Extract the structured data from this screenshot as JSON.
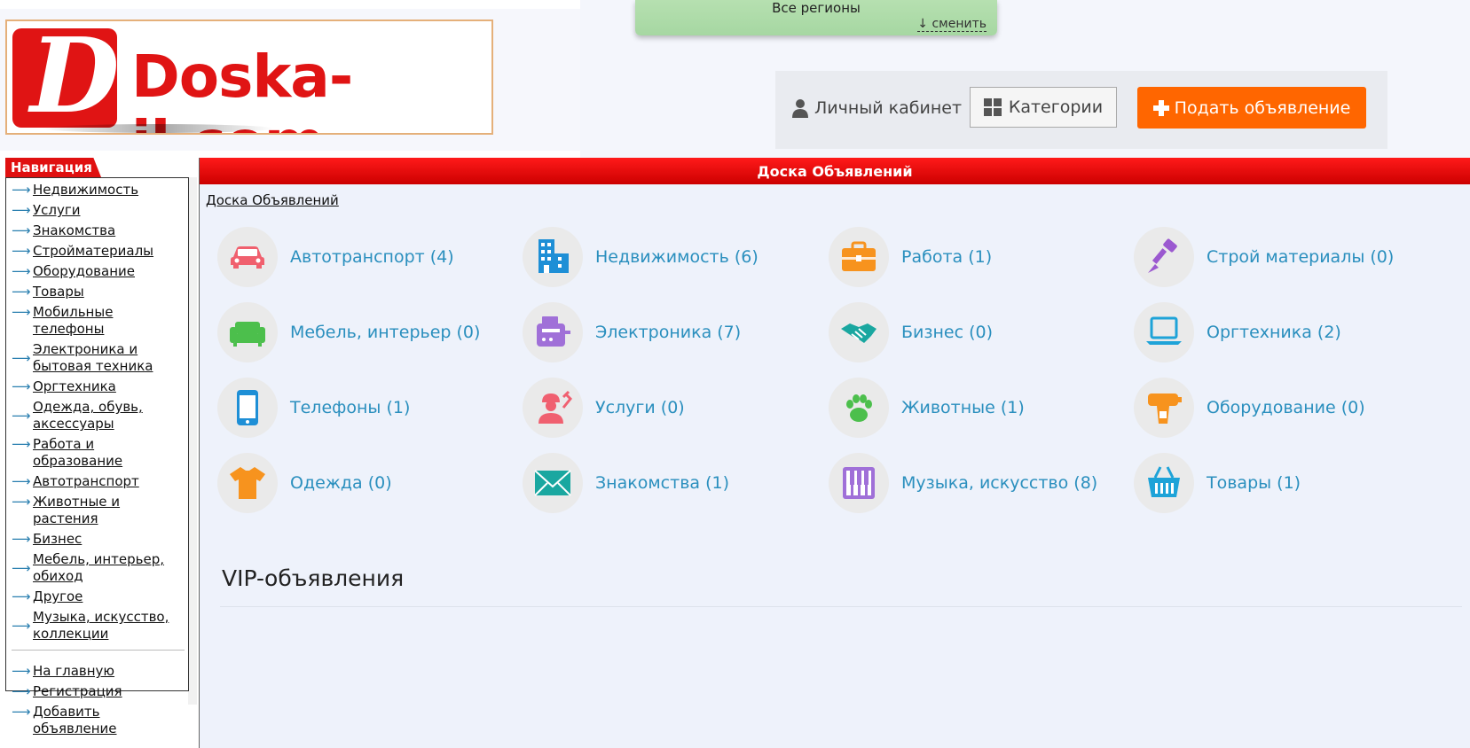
{
  "header": {
    "logo_text": "Doska-il.com",
    "region": {
      "label": "Все регионы",
      "change": "↓ сменить"
    },
    "toolbar": {
      "cabinet": "Личный кабинет",
      "categories": "Категории",
      "post_ad": "Подать объявление"
    }
  },
  "sidebar": {
    "title": "Навигация",
    "items": [
      "Недвижимость",
      "Услуги",
      "Знакомства",
      "Стройматериалы",
      "Оборудование",
      "Товары",
      "Мобильные телефоны",
      "Электроника и бытовая техника",
      "Оргтехника",
      "Одежда, обувь, аксессуары",
      "Работа и образование",
      "Автотранспорт",
      "Животные и растения",
      "Бизнес",
      "Мебель, интерьер, обиход",
      "Другое",
      "Музыка, искусство, коллекции"
    ],
    "bottom_items": [
      "На главную",
      "Регистрация",
      "Добавить объявление"
    ]
  },
  "main": {
    "title": "Доска Объявлений",
    "breadcrumb": "Доска Объявлений",
    "categories": [
      {
        "label": "Автотранспорт (4)",
        "icon": "car-icon",
        "color": "#f0606e"
      },
      {
        "label": "Недвижимость (6)",
        "icon": "building-icon",
        "color": "#1e8fd6"
      },
      {
        "label": "Работа (1)",
        "icon": "briefcase-icon",
        "color": "#f7931e"
      },
      {
        "label": "Строй материалы (0)",
        "icon": "paint-brush-icon",
        "color": "#9b59d0"
      },
      {
        "label": "Мебель, интерьер (0)",
        "icon": "sofa-icon",
        "color": "#4cbf4c"
      },
      {
        "label": "Электроника (7)",
        "icon": "toaster-icon",
        "color": "#a070d8"
      },
      {
        "label": "Бизнес (0)",
        "icon": "handshake-icon",
        "color": "#1aa7a0"
      },
      {
        "label": "Оргтехника (2)",
        "icon": "laptop-icon",
        "color": "#1ea3d8"
      },
      {
        "label": "Телефоны (1)",
        "icon": "phone-icon",
        "color": "#1e8fd6"
      },
      {
        "label": "Услуги (0)",
        "icon": "worker-icon",
        "color": "#f06070"
      },
      {
        "label": "Животные (1)",
        "icon": "paw-icon",
        "color": "#4cbf4c"
      },
      {
        "label": "Оборудование (0)",
        "icon": "drill-icon",
        "color": "#f7931e"
      },
      {
        "label": "Одежда (0)",
        "icon": "tshirt-icon",
        "color": "#f7931e"
      },
      {
        "label": "Знакомства (1)",
        "icon": "envelope-icon",
        "color": "#1aa7a0"
      },
      {
        "label": "Музыка, искусство (8)",
        "icon": "piano-icon",
        "color": "#a070d8"
      },
      {
        "label": "Товары (1)",
        "icon": "basket-icon",
        "color": "#1ea3d8"
      }
    ],
    "vip_title": "VIP-объявления"
  }
}
